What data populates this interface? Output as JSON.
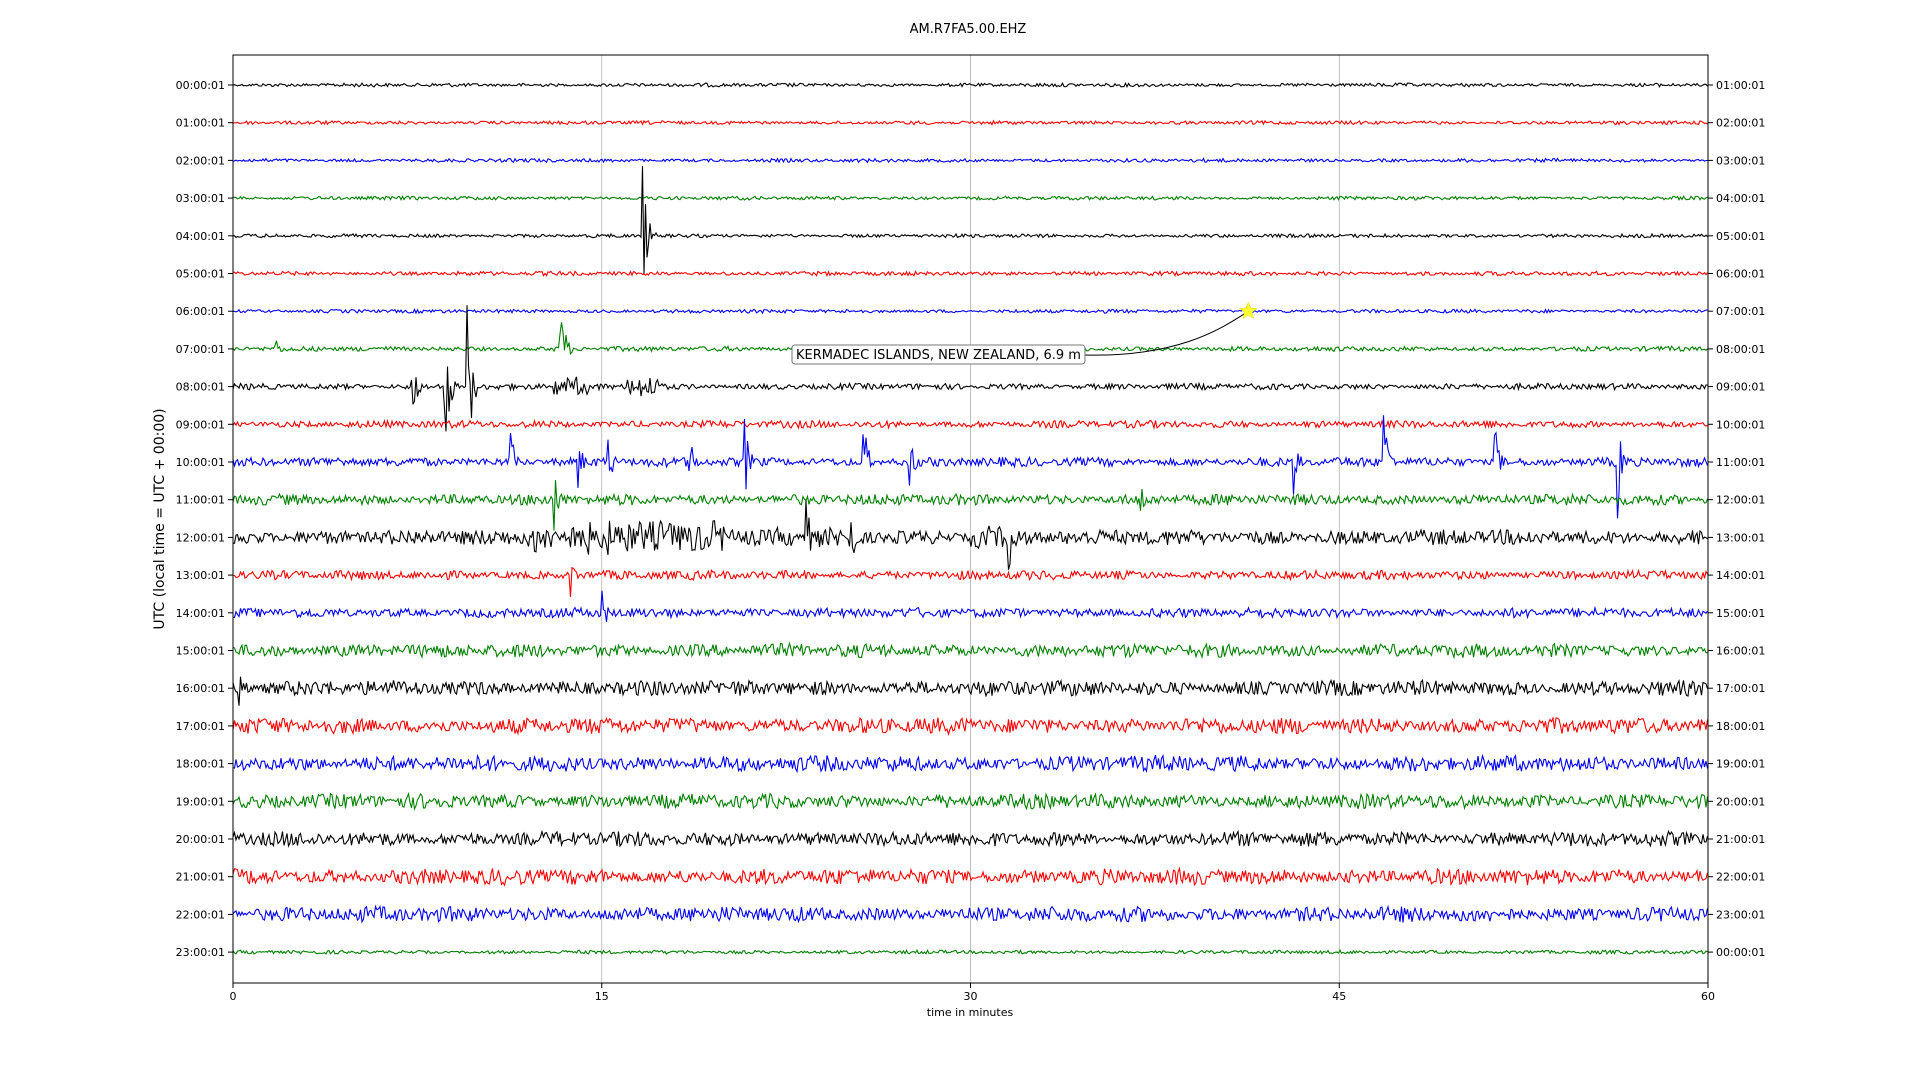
{
  "chart_data": {
    "type": "line",
    "title": "AM.R7FA5.00.EHZ",
    "xlabel": "time in minutes",
    "ylabel": "UTC (local time = UTC + 00:00)",
    "xlim": [
      0,
      60
    ],
    "x_ticks": [
      0,
      15,
      30,
      45,
      60
    ],
    "grid": "vertical",
    "left_labels": [
      "00:00:01",
      "01:00:01",
      "02:00:01",
      "03:00:01",
      "04:00:01",
      "05:00:01",
      "06:00:01",
      "07:00:01",
      "08:00:01",
      "09:00:01",
      "10:00:01",
      "11:00:01",
      "12:00:01",
      "13:00:01",
      "14:00:01",
      "15:00:01",
      "16:00:01",
      "17:00:01",
      "18:00:01",
      "19:00:01",
      "20:00:01",
      "21:00:01",
      "22:00:01",
      "23:00:01"
    ],
    "right_labels": [
      "01:00:01",
      "02:00:01",
      "03:00:01",
      "04:00:01",
      "05:00:01",
      "06:00:01",
      "07:00:01",
      "08:00:01",
      "09:00:01",
      "10:00:01",
      "11:00:01",
      "12:00:01",
      "13:00:01",
      "14:00:01",
      "15:00:01",
      "16:00:01",
      "17:00:01",
      "18:00:01",
      "19:00:01",
      "20:00:01",
      "21:00:01",
      "22:00:01",
      "23:00:01",
      "00:00:01"
    ],
    "colors": [
      "#000000",
      "#ff0000",
      "#0000ff",
      "#008000"
    ],
    "noise_level": [
      0.6,
      0.6,
      0.6,
      0.6,
      0.6,
      0.7,
      0.6,
      0.8,
      1.0,
      1.2,
      1.5,
      1.8,
      2.5,
      1.5,
      1.6,
      2.2,
      2.5,
      2.6,
      2.6,
      2.4,
      2.4,
      2.6,
      2.5,
      0.6
    ],
    "events": [
      {
        "row": 7,
        "x": 1.6,
        "amp": 30
      },
      {
        "row": 4,
        "x": 16.6,
        "amp": 110
      },
      {
        "row": 7,
        "x": 13.3,
        "amp": 70
      },
      {
        "row": 8,
        "x": 7.2,
        "amp": 70
      },
      {
        "row": 8,
        "x": 8.6,
        "amp": 90
      },
      {
        "row": 8,
        "x": 9.5,
        "amp": 110
      },
      {
        "row": 10,
        "x": 11.2,
        "amp": 60
      },
      {
        "row": 10,
        "x": 14.0,
        "amp": 40
      },
      {
        "row": 10,
        "x": 15.2,
        "amp": 45
      },
      {
        "row": 10,
        "x": 18.5,
        "amp": 55
      },
      {
        "row": 10,
        "x": 20.8,
        "amp": 50
      },
      {
        "row": 10,
        "x": 25.6,
        "amp": 60
      },
      {
        "row": 10,
        "x": 27.5,
        "amp": 50
      },
      {
        "row": 10,
        "x": 43.1,
        "amp": 45
      },
      {
        "row": 10,
        "x": 46.8,
        "amp": 70
      },
      {
        "row": 10,
        "x": 51.3,
        "amp": 55
      },
      {
        "row": 10,
        "x": 56.3,
        "amp": 70
      },
      {
        "row": 11,
        "x": 13.0,
        "amp": 55
      },
      {
        "row": 11,
        "x": 36.8,
        "amp": 45
      },
      {
        "row": 12,
        "x": 23.2,
        "amp": 80
      },
      {
        "row": 12,
        "x": 25.0,
        "amp": 85
      },
      {
        "row": 12,
        "x": 31.5,
        "amp": 100
      },
      {
        "row": 13,
        "x": 13.7,
        "amp": 30
      },
      {
        "row": 14,
        "x": 15.0,
        "amp": 30
      },
      {
        "row": 16,
        "x": 0.2,
        "amp": 25
      }
    ],
    "bursts": [
      {
        "row": 12,
        "x0": 12.0,
        "x1": 20.0,
        "amp": 18
      },
      {
        "row": 12,
        "x0": 22.0,
        "x1": 25.5,
        "amp": 10
      },
      {
        "row": 12,
        "x0": 30.0,
        "x1": 32.0,
        "amp": 12
      },
      {
        "row": 8,
        "x0": 13.0,
        "x1": 14.5,
        "amp": 10
      },
      {
        "row": 8,
        "x0": 16.0,
        "x1": 17.5,
        "amp": 12
      }
    ],
    "annotation": {
      "text": "KERMADEC ISLANDS, NEW ZEALAND, 6.9 m",
      "row": 6,
      "x": 41.3,
      "marker_color": "#ffff33"
    }
  }
}
